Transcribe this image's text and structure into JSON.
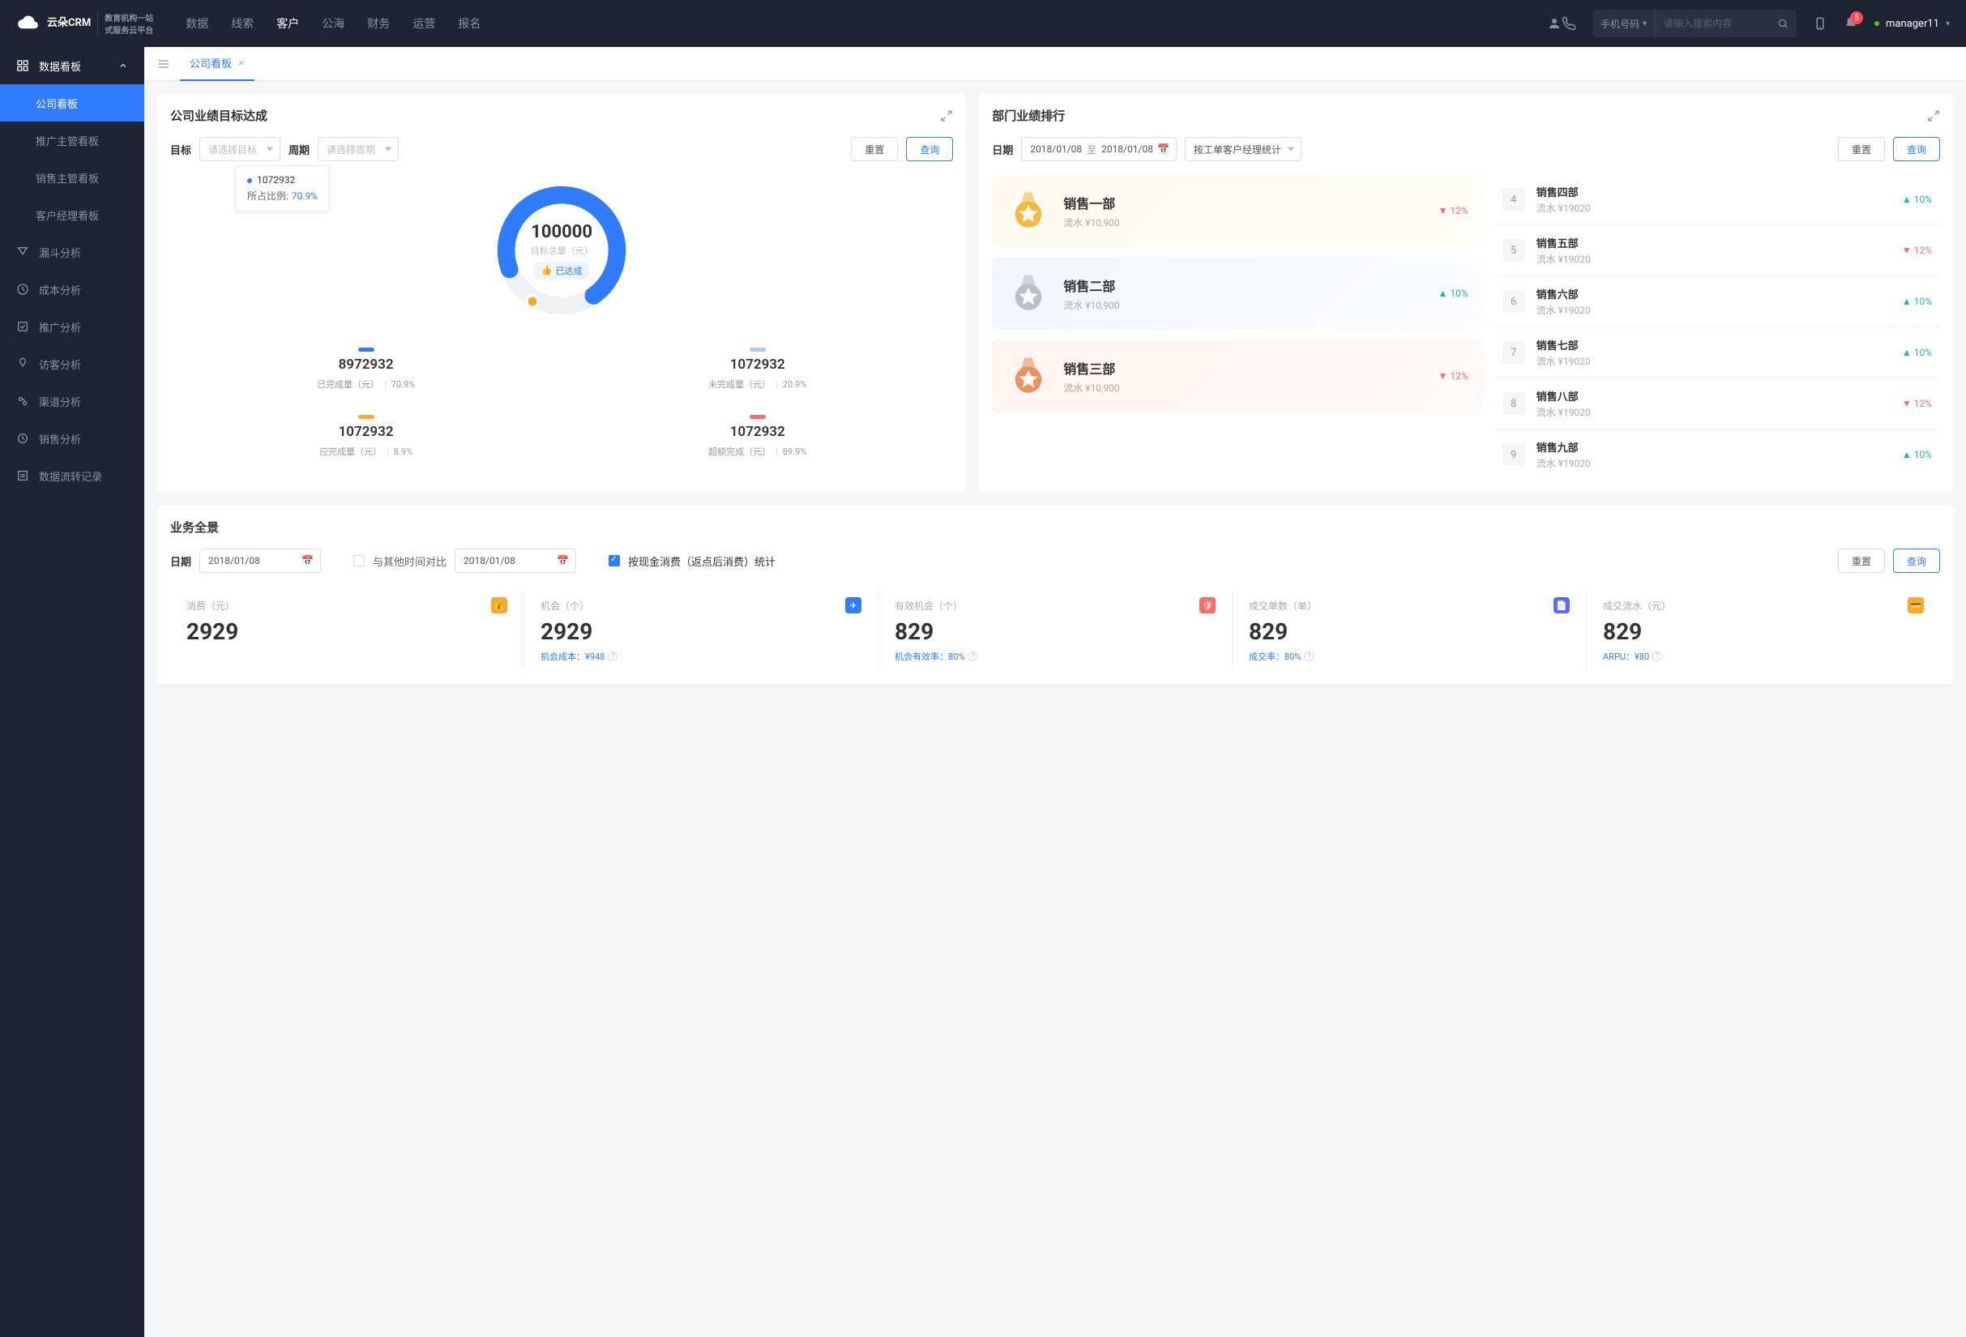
{
  "brand": {
    "name": "云朵CRM",
    "sub1": "教育机构一站",
    "sub2": "式服务云平台"
  },
  "nav": [
    "数据",
    "线索",
    "客户",
    "公海",
    "财务",
    "运营",
    "报名"
  ],
  "nav_active": 2,
  "search": {
    "type": "手机号码",
    "placeholder": "请输入搜索内容"
  },
  "notif_count": "5",
  "user": "manager11",
  "sidebar": {
    "header": "数据看板",
    "subs": [
      "公司看板",
      "推广主管看板",
      "销售主管看板",
      "客户经理看板"
    ],
    "active_sub": 0,
    "items": [
      "漏斗分析",
      "成本分析",
      "推广分析",
      "访客分析",
      "渠道分析",
      "销售分析",
      "数据流转记录"
    ]
  },
  "tab": "公司看板",
  "target": {
    "title": "公司业绩目标达成",
    "labels": {
      "target": "目标",
      "period": "周期"
    },
    "placeholders": {
      "target": "请选择目标",
      "period": "请选择周期"
    },
    "btns": {
      "reset": "重置",
      "query": "查询"
    },
    "tooltip": {
      "val": "1072932",
      "label": "所占比例:",
      "pct": "70.9%"
    },
    "center": {
      "val": "100000",
      "label": "目标总量（元）",
      "badge": "已达成"
    },
    "stats": [
      {
        "bar": "#2f7cff",
        "val": "8972932",
        "label": "已完成量（元）",
        "pct": "70.9%"
      },
      {
        "bar": "#a8ccff",
        "val": "1072932",
        "label": "未完成量（元）",
        "pct": "20.9%"
      },
      {
        "bar": "#ffa726",
        "val": "1072932",
        "label": "应完成量（元）",
        "pct": "8.9%"
      },
      {
        "bar": "#ff6b6b",
        "val": "1072932",
        "label": "超额完成（元）",
        "pct": "89.9%"
      }
    ]
  },
  "chart_data": {
    "type": "pie",
    "title": "公司业绩目标达成",
    "total_label": "目标总量（元）",
    "total": 100000,
    "series": [
      {
        "name": "已完成量（元）",
        "value": 8972932,
        "pct": 70.9,
        "color": "#2f7cff"
      },
      {
        "name": "未完成量（元）",
        "value": 1072932,
        "pct": 20.9,
        "color": "#a8ccff"
      },
      {
        "name": "应完成量（元）",
        "value": 1072932,
        "pct": 8.9,
        "color": "#ffa726"
      },
      {
        "name": "超额完成（元）",
        "value": 1072932,
        "pct": 89.9,
        "color": "#ff6b6b"
      }
    ]
  },
  "rank": {
    "title": "部门业绩排行",
    "labels": {
      "date": "日期",
      "to": "至"
    },
    "date1": "2018/01/08",
    "date2": "2018/01/08",
    "mode": "按工单客户经理统计",
    "btns": {
      "reset": "重置",
      "query": "查询"
    },
    "top": [
      {
        "name": "销售一部",
        "sub": "流水 ¥10,900",
        "trend": "down",
        "pct": "12%"
      },
      {
        "name": "销售二部",
        "sub": "流水 ¥10,900",
        "trend": "up",
        "pct": "10%"
      },
      {
        "name": "销售三部",
        "sub": "流水 ¥10,900",
        "trend": "down",
        "pct": "12%"
      }
    ],
    "list": [
      {
        "n": "4",
        "name": "销售四部",
        "sub": "流水 ¥19020",
        "trend": "up",
        "pct": "10%"
      },
      {
        "n": "5",
        "name": "销售五部",
        "sub": "流水 ¥19020",
        "trend": "down",
        "pct": "12%"
      },
      {
        "n": "6",
        "name": "销售六部",
        "sub": "流水 ¥19020",
        "trend": "up",
        "pct": "10%"
      },
      {
        "n": "7",
        "name": "销售七部",
        "sub": "流水 ¥19020",
        "trend": "up",
        "pct": "10%"
      },
      {
        "n": "8",
        "name": "销售八部",
        "sub": "流水 ¥19020",
        "trend": "down",
        "pct": "12%"
      },
      {
        "n": "9",
        "name": "销售九部",
        "sub": "流水 ¥19020",
        "trend": "up",
        "pct": "10%"
      }
    ]
  },
  "panorama": {
    "title": "业务全景",
    "labels": {
      "date": "日期",
      "compare": "与其他时间对比",
      "check": "按现金消费（返点后消费）统计"
    },
    "date1": "2018/01/08",
    "date2": "2018/01/08",
    "btns": {
      "reset": "重置",
      "query": "查询"
    },
    "kpis": [
      {
        "label": "消费（元）",
        "val": "2929",
        "sub": "",
        "ic": "#ffa726"
      },
      {
        "label": "机会（个）",
        "val": "2929",
        "sub": "机会成本：¥948",
        "ic": "#2f7cff"
      },
      {
        "label": "有效机会（个）",
        "val": "829",
        "sub": "机会有效率：80%",
        "ic": "#ff6b6b"
      },
      {
        "label": "成交单数（单）",
        "val": "829",
        "sub": "成交率：80%",
        "ic": "#5b6bff"
      },
      {
        "label": "成交流水（元）",
        "val": "829",
        "sub": "ARPU：¥80",
        "ic": "#ffa726"
      }
    ]
  }
}
